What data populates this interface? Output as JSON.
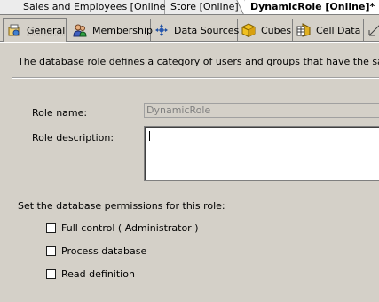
{
  "document_tabs": [
    {
      "label": "Sales and Employees [Online]",
      "active": false
    },
    {
      "label": "Store [Online]*",
      "active": false
    },
    {
      "label": "DynamicRole [Online]*",
      "active": true
    }
  ],
  "designer_tabs": [
    {
      "label": "General",
      "icon": "general-icon",
      "active": true
    },
    {
      "label": "Membership",
      "icon": "membership-icon",
      "active": false
    },
    {
      "label": "Data Sources",
      "icon": "data-sources-icon",
      "active": false
    },
    {
      "label": "Cubes",
      "icon": "cubes-icon",
      "active": false
    },
    {
      "label": "Cell Data",
      "icon": "cell-data-icon",
      "active": false
    }
  ],
  "general": {
    "description": "The database role defines a category of users and groups that have the same permis",
    "role_name_label": "Role name:",
    "role_name_value": "DynamicRole",
    "role_description_label": "Role description:",
    "role_description_value": "",
    "permissions_label": "Set the database permissions for this role:",
    "permissions": [
      {
        "label": "Full control ( Administrator )",
        "checked": false
      },
      {
        "label": "Process database",
        "checked": false
      },
      {
        "label": "Read definition",
        "checked": false
      }
    ]
  },
  "colors": {
    "panel": "#d4d0c8",
    "active_doc_tab": "#ffffff",
    "disabled_text": "#808080"
  }
}
